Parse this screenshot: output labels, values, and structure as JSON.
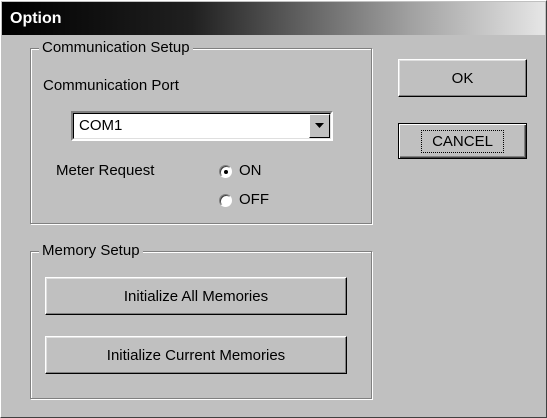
{
  "window": {
    "title": "Option"
  },
  "communication": {
    "group_label": "Communication Setup",
    "port_label": "Communication Port",
    "port_value": "COM1",
    "meter_label": "Meter Request",
    "options": [
      {
        "label": "ON",
        "selected": true
      },
      {
        "label": "OFF",
        "selected": false
      }
    ]
  },
  "memory": {
    "group_label": "Memory Setup",
    "init_all_label": "Initialize All Memories",
    "init_current_label": "Initialize Current Memories"
  },
  "buttons": {
    "ok_label": "OK",
    "cancel_label": "CANCEL"
  }
}
